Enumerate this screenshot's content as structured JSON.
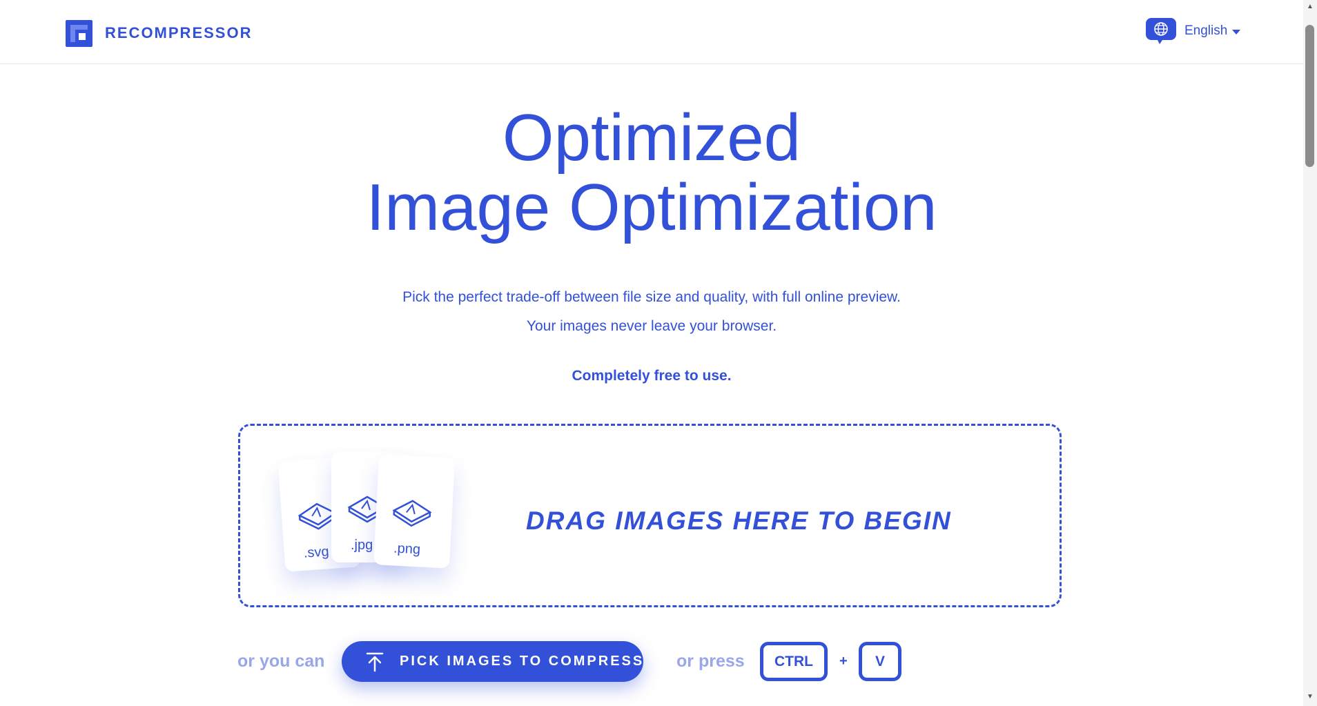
{
  "header": {
    "brand": "RECOMPRESSOR",
    "language": "English"
  },
  "hero": {
    "line1": "Optimized",
    "line2": "Image Optimization",
    "subtitle1": "Pick the perfect trade-off between file size and quality, with full online preview.",
    "subtitle2": "Your images never leave your browser.",
    "free": "Completely free to use."
  },
  "dropzone": {
    "text": "DRAG IMAGES HERE TO BEGIN",
    "files": [
      ".svg",
      ".jpg",
      ".png"
    ]
  },
  "actions": {
    "or_you_can": "or you can",
    "pick_label": "PICK IMAGES TO COMPRESS",
    "or_press": "or press",
    "key_ctrl": "CTRL",
    "plus": "+",
    "key_v": "V"
  },
  "colors": {
    "accent": "#3350d8",
    "muted": "#9aa6ea"
  },
  "icons": [
    "logo-icon",
    "globe-icon",
    "caret-down-icon",
    "image-icon",
    "upload-icon"
  ]
}
